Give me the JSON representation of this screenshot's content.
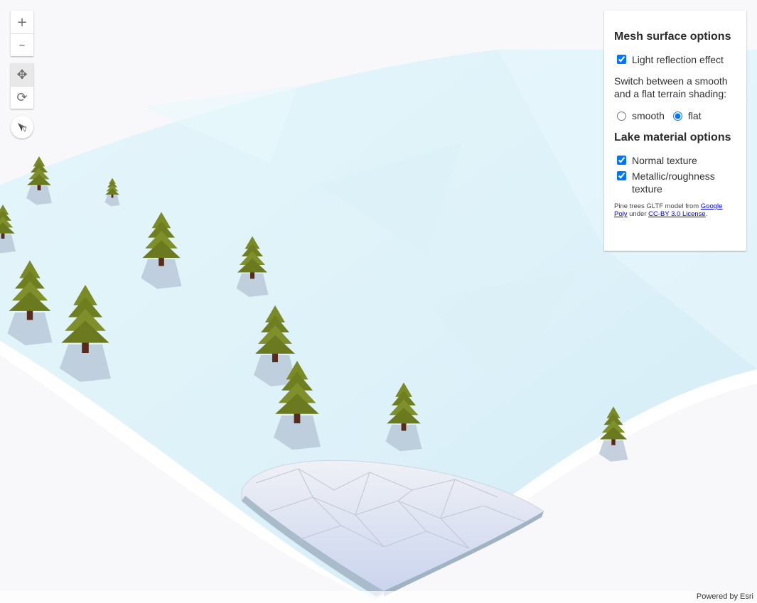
{
  "navigation": {
    "zoom_in": "+",
    "zoom_out": "–",
    "pan": "✥",
    "rotate": "⟳"
  },
  "icons": {
    "zoom_in": "plus-icon",
    "zoom_out": "minus-icon",
    "pan": "pan-icon",
    "rotate": "rotate-icon",
    "compass": "compass-icon"
  },
  "panel": {
    "mesh_title": "Mesh surface options",
    "light_reflection_label": "Light reflection effect",
    "light_reflection_checked": true,
    "shading_description": "Switch between a smooth and a flat terrain shading:",
    "smooth_label": "smooth",
    "flat_label": "flat",
    "shading_selected": "flat",
    "lake_title": "Lake material options",
    "normal_texture_label": "Normal texture",
    "normal_texture_checked": true,
    "metallic_label": "Metallic/roughness texture",
    "metallic_checked": true,
    "credit_prefix": "Pine trees GLTF model from",
    "credit_link1": "Google Poly",
    "credit_middle": "under",
    "credit_link2": "CC-BY 3.0 License",
    "credit_suffix": "."
  },
  "attribution": "Powered by Esri",
  "colors": {
    "terrain": "#dff3f8",
    "tree_foliage": "#7a8a25",
    "tree_trunk": "#5a2b1a",
    "lake": "#e9ecf5"
  }
}
